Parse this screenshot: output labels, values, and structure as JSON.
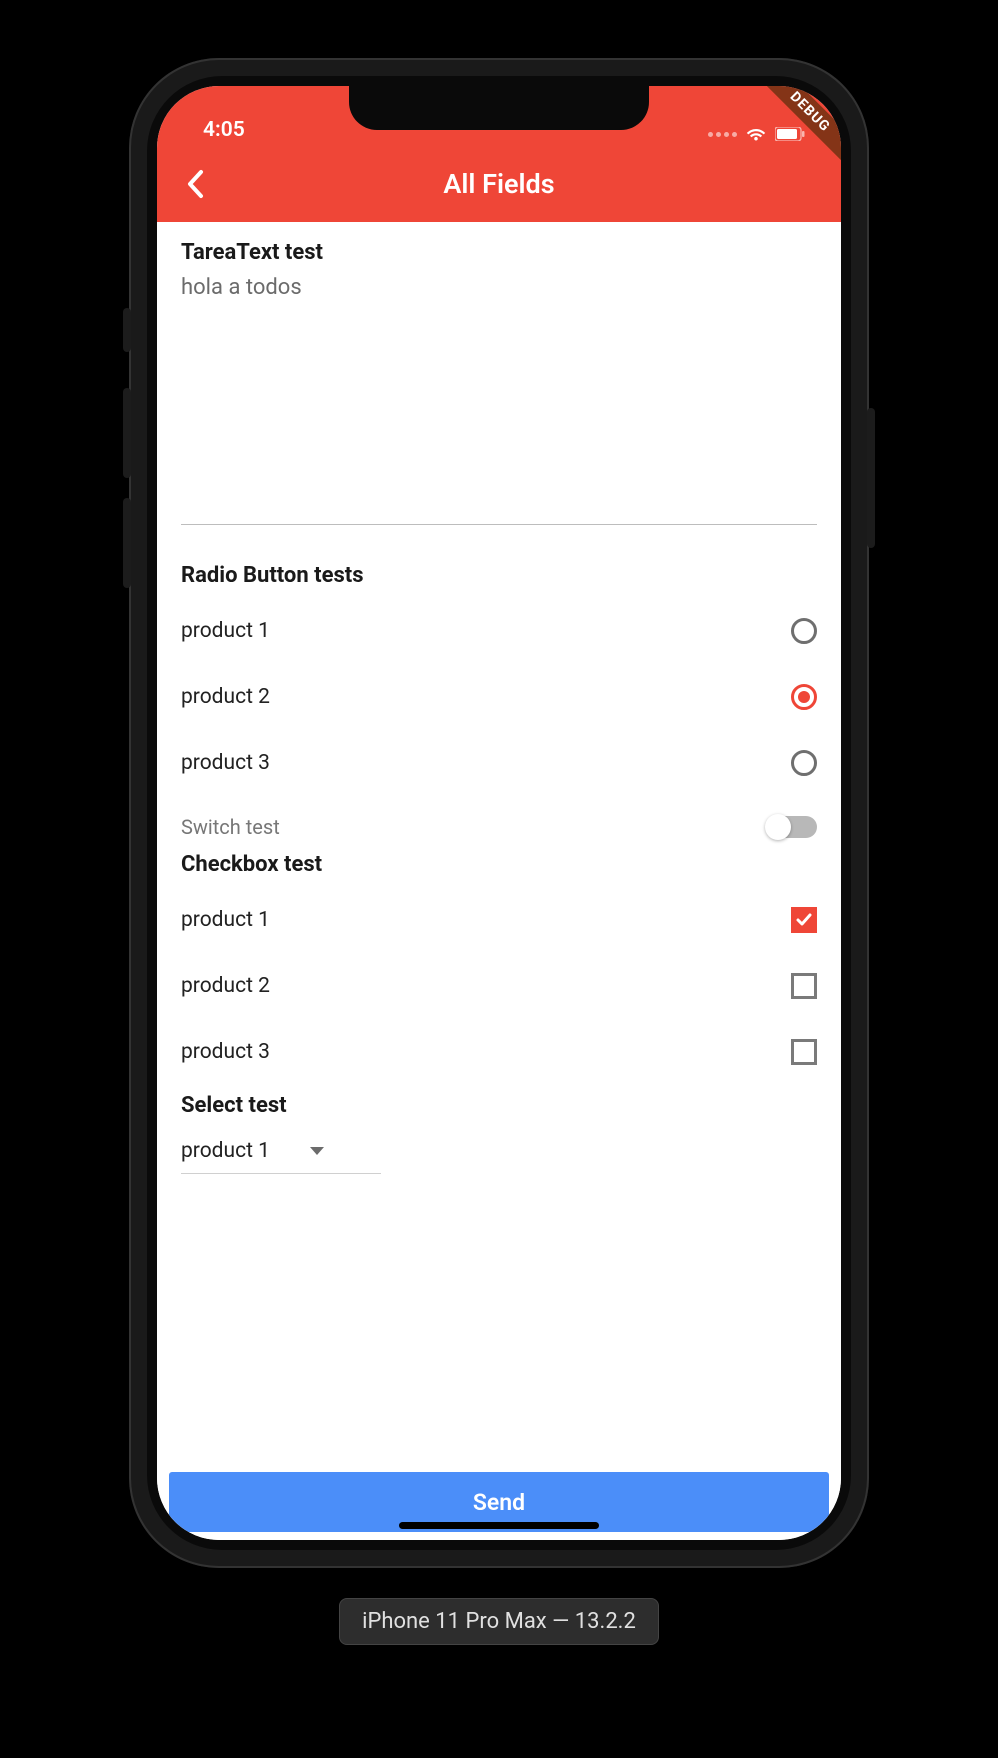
{
  "status": {
    "time": "4:05"
  },
  "debug_label": "DEBUG",
  "appbar": {
    "title": "All Fields"
  },
  "textarea": {
    "label": "TareaText test",
    "value": "hola a todos"
  },
  "radio": {
    "label": "Radio Button tests",
    "options": [
      {
        "label": "product 1",
        "selected": false
      },
      {
        "label": "product 2",
        "selected": true
      },
      {
        "label": "product 3",
        "selected": false
      }
    ]
  },
  "switch": {
    "label": "Switch test",
    "value": false
  },
  "checkbox": {
    "label": "Checkbox test",
    "options": [
      {
        "label": "product 1",
        "checked": true
      },
      {
        "label": "product 2",
        "checked": false
      },
      {
        "label": "product 3",
        "checked": false
      }
    ]
  },
  "select": {
    "label": "Select test",
    "value": "product 1"
  },
  "send_label": "Send",
  "footer": "iPhone 11 Pro Max — 13.2.2"
}
